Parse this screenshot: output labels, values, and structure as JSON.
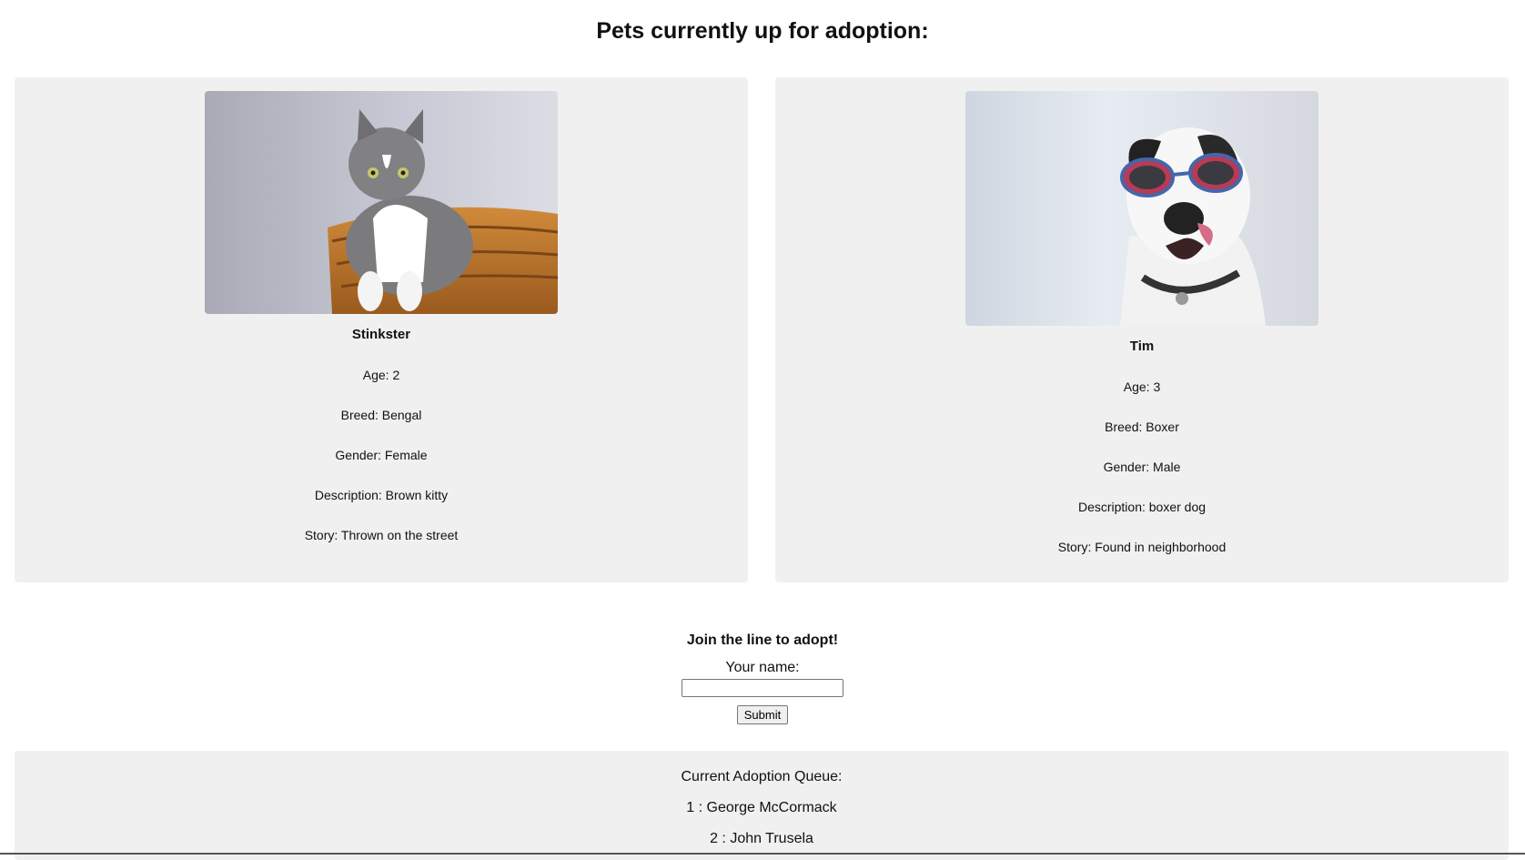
{
  "page": {
    "title": "Pets currently up for adoption:"
  },
  "pets": [
    {
      "photo_subject": "cat-in-basket",
      "name": "Stinkster",
      "age": "Age: 2",
      "breed": "Breed: Bengal",
      "gender": "Gender: Female",
      "description": "Description: Brown kitty",
      "story": "Story: Thrown on the street"
    },
    {
      "photo_subject": "dog-with-sunglasses",
      "name": "Tim",
      "age": "Age: 3",
      "breed": "Breed: Boxer",
      "gender": "Gender: Male",
      "description": "Description: boxer dog",
      "story": "Story: Found in neighborhood"
    }
  ],
  "adopt_form": {
    "heading": "Join the line to adopt!",
    "name_label": "Your name:",
    "name_value": "",
    "submit_label": "Submit"
  },
  "queue": {
    "title": "Current Adoption Queue:",
    "entries": [
      "1 : George McCormack",
      "2 : John Trusela"
    ]
  },
  "colors": {
    "card_background": "#f0f0f0",
    "page_background": "#ffffff"
  }
}
